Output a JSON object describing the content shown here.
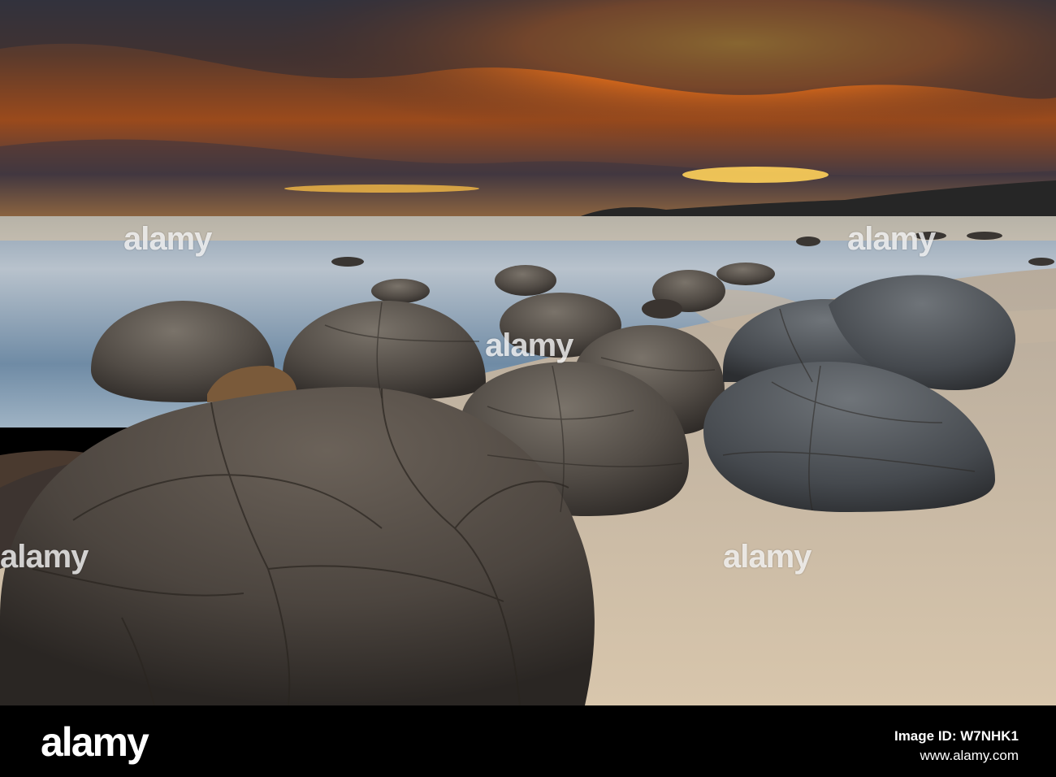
{
  "image": {
    "subject": "sunset beach with spherical boulders",
    "sky_colors": [
      "#2a2a3a",
      "#e9731c",
      "#ffb02c"
    ],
    "sand_color": "#c9b8a0",
    "boulder_color": "#5f5953"
  },
  "watermark": {
    "word": "alamy",
    "marks": [
      "alamy",
      "alamy",
      "alamy",
      "alamy",
      "alamy",
      "alamy",
      "alamy",
      "alamy",
      "alamy"
    ]
  },
  "footer": {
    "logo": "alamy",
    "image_id_label": "Image ID: W7NHK1",
    "site": "www.alamy.com"
  }
}
